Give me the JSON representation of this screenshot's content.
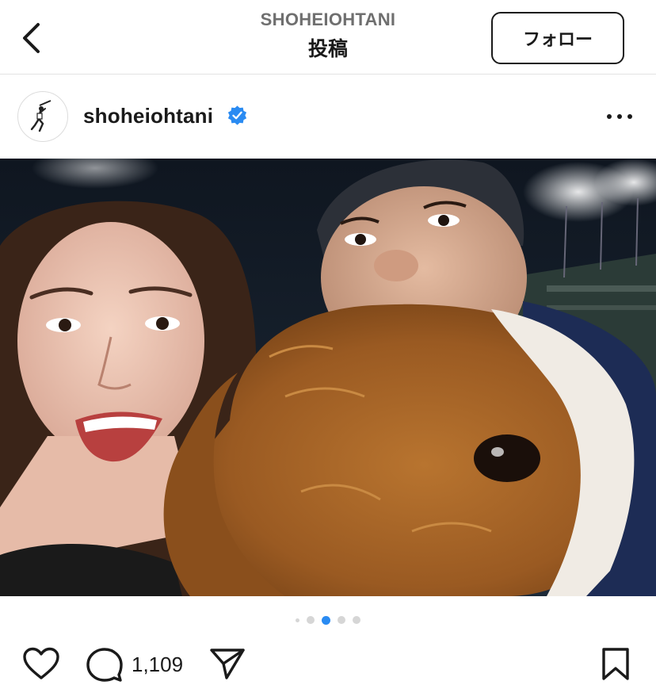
{
  "header": {
    "username": "SHOHEIOHTANI",
    "title": "投稿",
    "follow_label": "フォロー"
  },
  "post": {
    "username": "shoheiohtani",
    "verified": true,
    "comment_count": "1,109"
  },
  "carousel": {
    "total": 5,
    "active_index": 2
  },
  "colors": {
    "accent": "#2a8bf2",
    "text": "#1a1a1a",
    "muted": "#6f6f6f"
  },
  "icons": [
    "back-icon",
    "verified-icon",
    "more-icon",
    "heart-icon",
    "comment-icon",
    "share-icon",
    "bookmark-icon"
  ]
}
